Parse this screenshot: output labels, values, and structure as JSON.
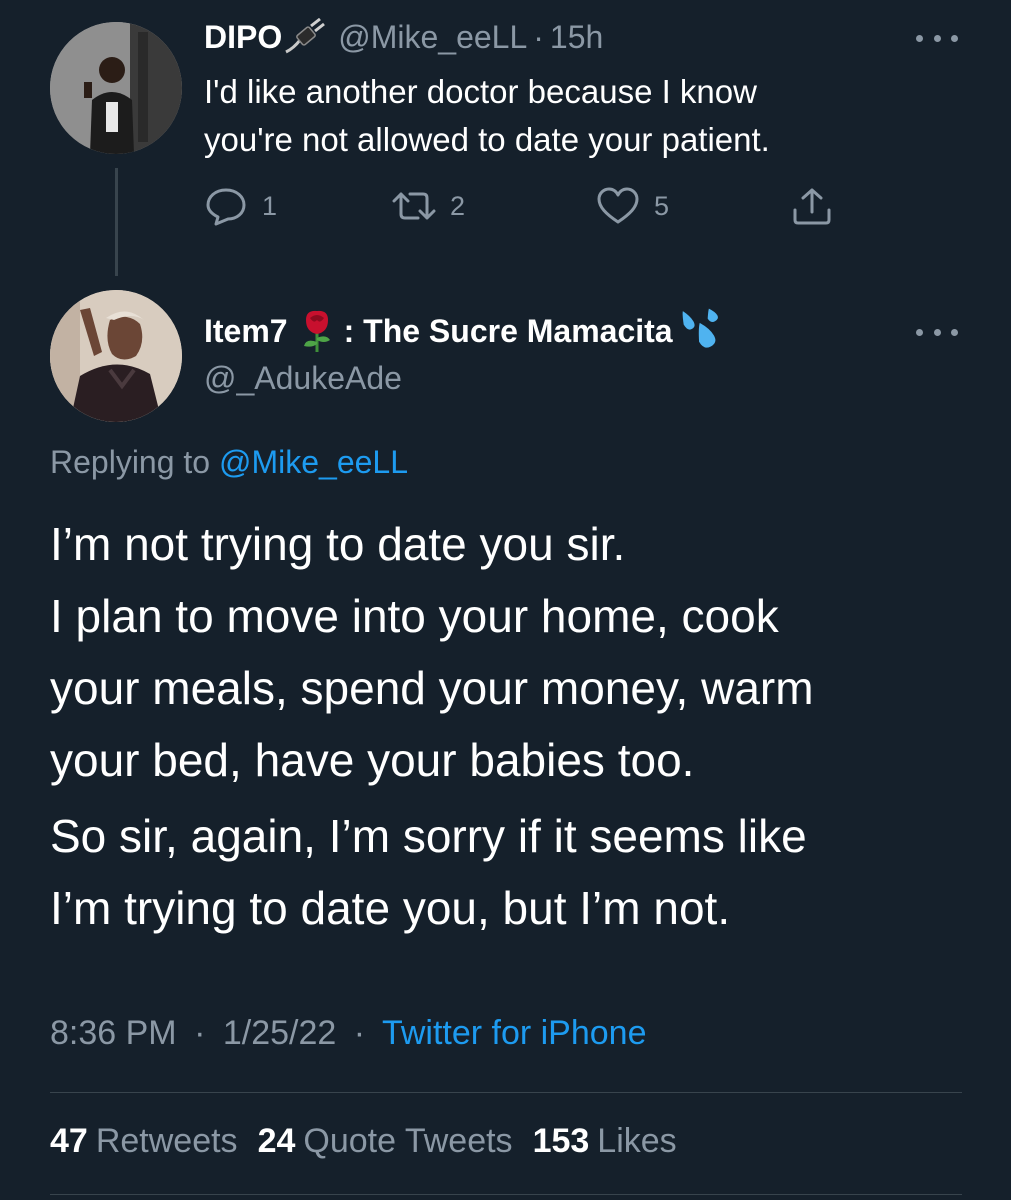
{
  "parent_tweet": {
    "display_name": "DIPO",
    "name_emoji": "electric-plug-icon",
    "handle": "@Mike_eeLL",
    "separator": "·",
    "time": "15h",
    "text_lines": [
      "I'd like another doctor because I know",
      "you're not allowed to date your patient."
    ],
    "actions": {
      "reply_count": "1",
      "retweet_count": "2",
      "like_count": "5"
    }
  },
  "main_tweet": {
    "display_name": "Item7",
    "name_middle": ": The Sucre Mamacita",
    "name_emojis": [
      "rose-icon",
      "sweat-droplets-icon"
    ],
    "handle": "@_AdukeAde",
    "replying_prefix": "Replying to",
    "replying_to": "@Mike_eeLL",
    "paragraphs": [
      [
        "I’m not trying to date you sir.",
        "I plan to move into your home, cook",
        "your meals, spend your money, warm",
        "your bed, have your babies too."
      ],
      [
        "So sir, again, I’m sorry if it seems like",
        "I’m trying to date you, but I’m not."
      ]
    ],
    "time": "8:36 PM",
    "date": "1/25/22",
    "separator": "·",
    "source": "Twitter for iPhone",
    "stats": {
      "retweets_count": "47",
      "retweets_label": "Retweets",
      "quotes_count": "24",
      "quotes_label": "Quote Tweets",
      "likes_count": "153",
      "likes_label": "Likes"
    }
  },
  "colors": {
    "background": "#15202b",
    "text_primary": "#ffffff",
    "text_secondary": "#8b98a5",
    "link": "#1d9bf0",
    "divider": "#38444d"
  }
}
